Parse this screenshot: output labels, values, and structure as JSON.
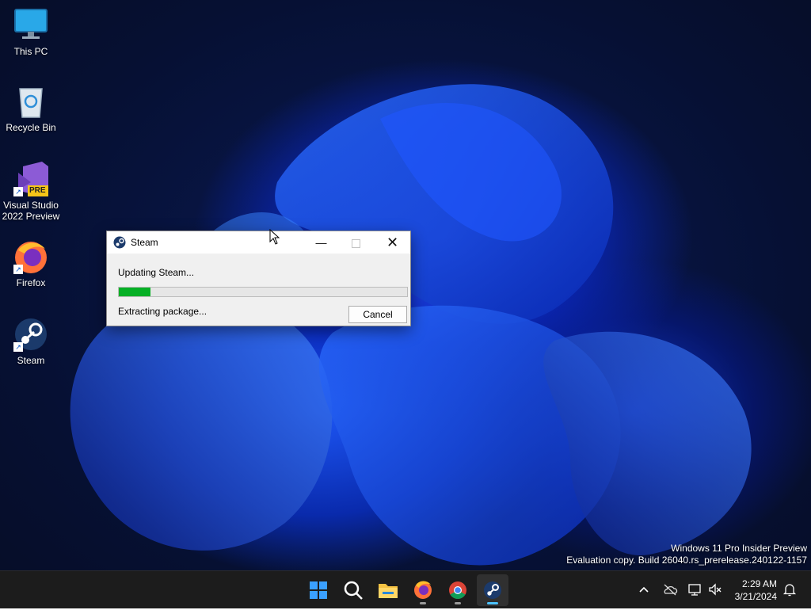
{
  "desktop": {
    "icons": [
      {
        "label": "This PC",
        "icon": "this-pc-icon"
      },
      {
        "label": "Recycle Bin",
        "icon": "recycle-bin-icon"
      },
      {
        "label": "Visual Studio\n2022 Preview",
        "icon": "visual-studio-icon",
        "badge": "PRE"
      },
      {
        "label": "Firefox",
        "icon": "firefox-icon"
      },
      {
        "label": "Steam",
        "icon": "steam-icon"
      }
    ],
    "watermark": {
      "line1": "Windows 11 Pro Insider Preview",
      "line2": "Evaluation copy. Build 26040.rs_prerelease.240122-1157"
    }
  },
  "steam_dialog": {
    "title": "Steam",
    "status": "Updating Steam...",
    "progress_percent": 11,
    "detail": "Extracting package...",
    "cancel_label": "Cancel",
    "controls": {
      "minimize": "minimize-icon",
      "maximize": "maximize-icon",
      "close": "close-icon"
    }
  },
  "taskbar": {
    "apps": [
      "start-icon",
      "search-icon",
      "file-explorer-icon",
      "firefox-icon",
      "chrome-icon",
      "steam-icon"
    ],
    "active_app": "steam-icon",
    "tray": [
      "chevron-up-icon",
      "onedrive-icon",
      "network-icon",
      "volume-muted-icon"
    ],
    "clock": {
      "time": "2:29 AM",
      "date": "3/21/2024"
    },
    "notification_icon": "bell-icon"
  },
  "colors": {
    "progress": "#06b025",
    "taskbar_bg": "#1c1c1c",
    "active_indicator": "#4cc2ff"
  }
}
